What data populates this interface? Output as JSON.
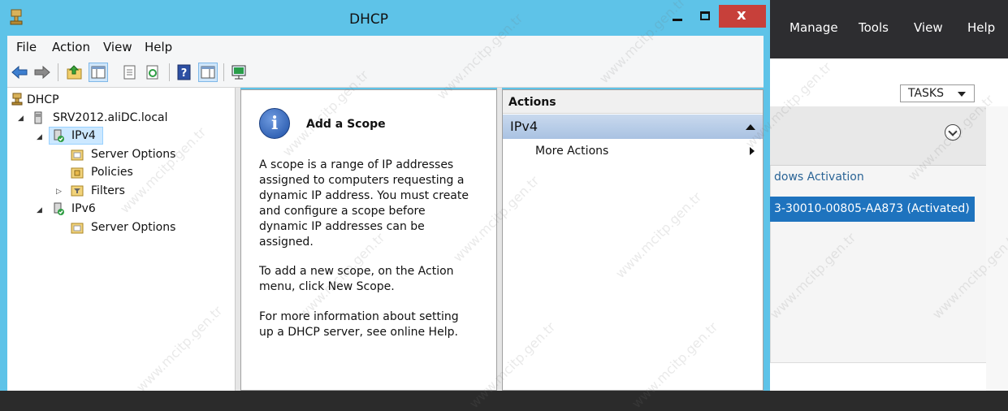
{
  "background_window": {
    "menu": [
      "Manage",
      "Tools",
      "View",
      "Help"
    ],
    "tasks_label": "TASKS",
    "windows_activation_text": "dows Activation",
    "activated_text": "3-30010-00805-AA873 (Activated)"
  },
  "window": {
    "title": "DHCP",
    "close_glyph": "x"
  },
  "menubar": [
    "File",
    "Action",
    "View",
    "Help"
  ],
  "toolbar_icons": [
    "back-icon",
    "forward-icon",
    "up-folder-icon",
    "show-hide-tree-icon",
    "properties-icon",
    "refresh-icon",
    "help-icon",
    "show-action-pane-icon",
    "console-icon"
  ],
  "tree": {
    "root": "DHCP",
    "server": "SRV2012.aliDC.local",
    "ipv4": "IPv4",
    "ipv4_children": [
      "Server Options",
      "Policies",
      "Filters"
    ],
    "ipv6": "IPv6",
    "ipv6_children": [
      "Server Options"
    ]
  },
  "middle": {
    "title": "Add a Scope",
    "para1": "A scope is a range of IP addresses assigned to computers requesting a dynamic IP address. You must create and configure a scope before dynamic IP addresses can be assigned.",
    "para2": "To add a new scope, on the Action menu, click New Scope.",
    "para3": "For more information about setting up a DHCP server, see online Help."
  },
  "actions": {
    "header": "Actions",
    "section": "IPv4",
    "item": "More Actions"
  },
  "watermark": "www.mcitp.gen.tr",
  "colors": {
    "window_frame": "#5ec3e8",
    "close_button": "#c7403a",
    "selection": "#cce8ff",
    "activated_row": "#1e73be"
  }
}
